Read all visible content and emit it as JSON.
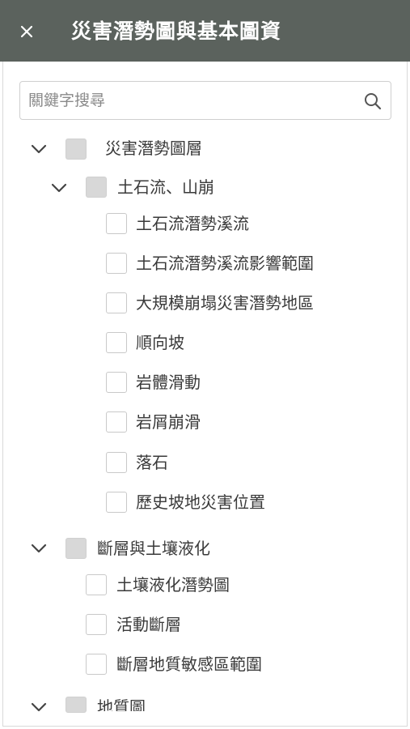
{
  "header": {
    "title": "災害潛勢圖與基本圖資",
    "close_icon": "close-icon"
  },
  "search": {
    "placeholder": "關鍵字搜尋",
    "value": "",
    "icon": "search-icon"
  },
  "tree": {
    "hazard_group": {
      "label": "災害潛勢圖層",
      "expanded": true,
      "checked": false,
      "debris_group": {
        "label": "土石流、山崩",
        "expanded": true,
        "checked": false,
        "items": [
          {
            "label": "土石流潛勢溪流",
            "checked": false
          },
          {
            "label": "土石流潛勢溪流影響範圍",
            "checked": false
          },
          {
            "label": "大規模崩塌災害潛勢地區",
            "checked": false
          },
          {
            "label": "順向坡",
            "checked": false
          },
          {
            "label": "岩體滑動",
            "checked": false
          },
          {
            "label": "岩屑崩滑",
            "checked": false
          },
          {
            "label": "落石",
            "checked": false
          },
          {
            "label": "歷史坡地災害位置",
            "checked": false
          }
        ]
      }
    },
    "fault_group": {
      "label": "斷層與土壤液化",
      "expanded": true,
      "checked": false,
      "items": [
        {
          "label": "土壤液化潛勢圖",
          "checked": false
        },
        {
          "label": "活動斷層",
          "checked": false
        },
        {
          "label": "斷層地質敏感區範圍",
          "checked": false
        }
      ]
    },
    "geology_group": {
      "label": "地質圖",
      "expanded": true,
      "checked": false
    }
  },
  "colors": {
    "header_bg": "#5b625d",
    "header_text": "#ffffff",
    "group_checkbox": "#d8d8d8",
    "leaf_checkbox_border": "#c9c9c9"
  }
}
